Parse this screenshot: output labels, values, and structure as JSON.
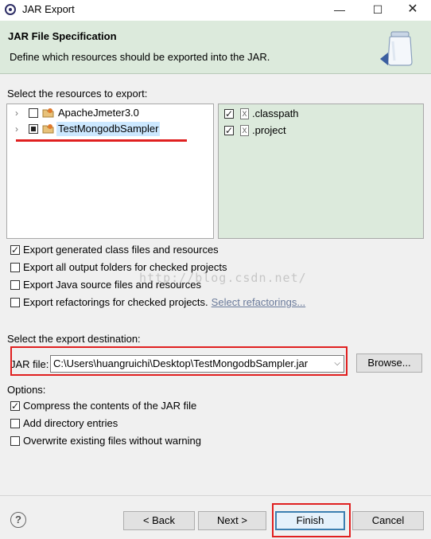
{
  "window": {
    "title": "JAR Export",
    "min_glyph": "—",
    "max_glyph": "☐",
    "close_glyph": "✕"
  },
  "banner": {
    "title": "JAR File Specification",
    "description": "Define which resources should be exported into the JAR.",
    "icon": "jar-icon"
  },
  "resources": {
    "label": "Select the resources to export:",
    "projects": [
      {
        "label": "ApacheJmeter3.0",
        "state": "unchecked",
        "icon": "java-project-icon"
      },
      {
        "label": "TestMongodbSampler",
        "state": "partial",
        "icon": "java-project-icon",
        "selected": true
      }
    ],
    "files": [
      {
        "label": ".classpath",
        "checked": true,
        "icon": "xml-file-icon",
        "glyph": "X"
      },
      {
        "label": ".project",
        "checked": true,
        "icon": "xml-file-icon",
        "glyph": "X"
      }
    ]
  },
  "export_options": [
    {
      "label": "Export generated class files and resources",
      "checked": true
    },
    {
      "label": "Export all output folders for checked projects",
      "checked": false
    },
    {
      "label": "Export Java source files and resources",
      "checked": false
    },
    {
      "label": "Export refactorings for checked projects.",
      "checked": false,
      "link": "Select refactorings..."
    }
  ],
  "destination": {
    "label": "Select the export destination:",
    "jar_label": "JAR file:",
    "jar_value": "C:\\Users\\huangruichi\\Desktop\\TestMongodbSampler.jar",
    "browse_label": "Browse..."
  },
  "options": {
    "label": "Options:",
    "items": [
      {
        "label": "Compress the contents of the JAR file",
        "checked": true
      },
      {
        "label": "Add directory entries",
        "checked": false
      },
      {
        "label": "Overwrite existing files without warning",
        "checked": false
      }
    ]
  },
  "watermark": "http://blog.csdn.net/",
  "buttons": {
    "help": "?",
    "back": "< Back",
    "next": "Next >",
    "finish": "Finish",
    "cancel": "Cancel"
  },
  "colors": {
    "banner_bg": "#dceadc",
    "annotation_red": "#e02020",
    "selection": "#cce8ff",
    "default_button_border": "#3c7fb1"
  }
}
